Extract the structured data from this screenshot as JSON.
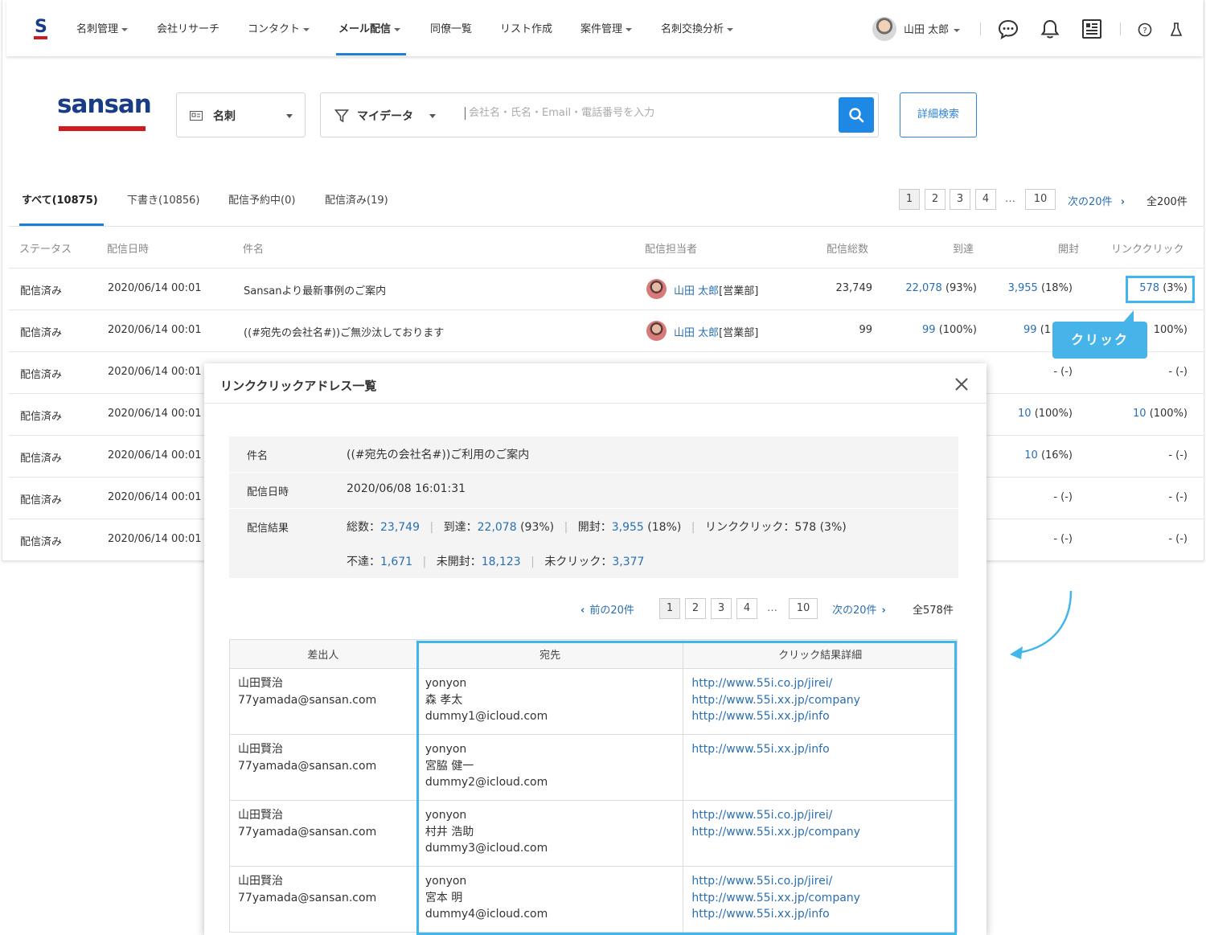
{
  "nav": {
    "items": [
      {
        "label": "名刺管理",
        "caret": true
      },
      {
        "label": "会社リサーチ",
        "caret": false
      },
      {
        "label": "コンタクト",
        "caret": true
      },
      {
        "label": "メール配信",
        "caret": true
      },
      {
        "label": "同僚一覧",
        "caret": false
      },
      {
        "label": "リスト作成",
        "caret": false
      },
      {
        "label": "案件管理",
        "caret": true
      },
      {
        "label": "名刺交換分析",
        "caret": true
      }
    ],
    "user_name": "山田 太郎"
  },
  "search": {
    "logo_text": "sansan",
    "scope_label": "名刺",
    "filter_label": "マイデータ",
    "placeholder": "会社名・氏名・Email・電話番号を入力",
    "advanced_label": "詳細検索"
  },
  "tabs": [
    {
      "label": "すべて(10875)",
      "active": true
    },
    {
      "label": "下書き(10856)",
      "active": false
    },
    {
      "label": "配信予約中(0)",
      "active": false
    },
    {
      "label": "配信済み(19)",
      "active": false
    }
  ],
  "pagination": {
    "pages": [
      "1",
      "2",
      "3",
      "4",
      "10"
    ],
    "current": "1",
    "ellipsis": "…",
    "next_label": "次の20件",
    "total": "全200件"
  },
  "table": {
    "headers": [
      "ステータス",
      "配信日時",
      "件名",
      "配信担当者",
      "配信総数",
      "到達",
      "開封",
      "リンククリック"
    ],
    "rows": [
      {
        "status": "配信済み",
        "date": "2020/06/14 00:01",
        "subject": "Sansanより最新事例のご案内",
        "owner": "山田 太郎",
        "dept": "[営業部]",
        "total": "23,749",
        "reach_n": "22,078",
        "reach_p": "(93%)",
        "open_n": "3,955",
        "open_p": "(18%)",
        "click_n": "578",
        "click_p": "(3%)"
      },
      {
        "status": "配信済み",
        "date": "2020/06/14 00:01",
        "subject": "((#宛先の会社名#))ご無沙汰しております",
        "owner": "山田 太郎",
        "dept": "[営業部]",
        "total": "99",
        "reach_n": "99",
        "reach_p": "(100%)",
        "open_n": "99",
        "open_p": "(1",
        "click_n": "",
        "click_p": "100%)"
      },
      {
        "status": "配信済み",
        "date": "2020/06/14 00:01",
        "open_n": "",
        "open_p": "- (-)",
        "click_n": "",
        "click_p": "- (-)"
      },
      {
        "status": "配信済み",
        "date": "2020/06/14 00:01",
        "open_n": "10",
        "open_p": "(100%)",
        "click_n": "10",
        "click_p": "(100%)"
      },
      {
        "status": "配信済み",
        "date": "2020/06/14 00:01",
        "open_n": "10",
        "open_p": "(16%)",
        "click_n": "",
        "click_p": "- (-)"
      },
      {
        "status": "配信済み",
        "date": "2020/06/14 00:01",
        "open_n": "",
        "open_p": "- (-)",
        "click_n": "",
        "click_p": "- (-)"
      },
      {
        "status": "配信済み",
        "date": "2020/06/14 00:01",
        "open_n": "",
        "open_p": "- (-)",
        "click_n": "",
        "click_p": "- (-)"
      }
    ]
  },
  "tooltip": {
    "label": "クリック"
  },
  "modal": {
    "title": "リンククリックアドレス一覧",
    "info": {
      "subject_label": "件名",
      "subject": "((#宛先の会社名#))ご利用のご案内",
      "date_label": "配信日時",
      "date": "2020/06/08 16:01:31",
      "result_label": "配信結果",
      "total_label": "総数：",
      "total": "23,749",
      "reach_label": "到達：",
      "reach": "22,078",
      "reach_p": "(93%)",
      "open_label": "開封：",
      "open": "3,955",
      "open_p": "(18%)",
      "click_label": "リンククリック：578 (3%)",
      "undelivered_label": "不達：",
      "undelivered": "1,671",
      "unopened_label": "未開封：",
      "unopened": "18,123",
      "unclicked_label": "未クリック：",
      "unclicked": "3,377"
    },
    "pagination": {
      "prev_label": "前の20件",
      "pages": [
        "1",
        "2",
        "3",
        "4",
        "10"
      ],
      "ellipsis": "…",
      "next_label": "次の20件",
      "total": "全578件"
    },
    "table": {
      "headers": [
        "差出人",
        "宛先",
        "クリック結果詳細"
      ],
      "rows": [
        {
          "sender": [
            "山田賢治",
            "77yamada@sansan.com"
          ],
          "recipient": [
            "yonyon",
            "森 孝太",
            "dummy1@icloud.com"
          ],
          "links": [
            "http://www.55i.co.jp/jirei/",
            "http://www.55i.xx.jp/company",
            "http://www.55i.xx.jp/info"
          ]
        },
        {
          "sender": [
            "山田賢治",
            "77yamada@sansan.com"
          ],
          "recipient": [
            "yonyon",
            "宮脇 健一",
            "dummy2@icloud.com"
          ],
          "links": [
            "http://www.55i.xx.jp/info"
          ]
        },
        {
          "sender": [
            "山田賢治",
            "77yamada@sansan.com"
          ],
          "recipient": [
            "yonyon",
            "村井 浩助",
            "dummy3@icloud.com"
          ],
          "links": [
            "http://www.55i.co.jp/jirei/",
            "http://www.55i.xx.jp/company"
          ]
        },
        {
          "sender": [
            "山田賢治",
            "77yamada@sansan.com"
          ],
          "recipient": [
            "yonyon",
            "宮本 明",
            "dummy4@icloud.com"
          ],
          "links": [
            "http://www.55i.co.jp/jirei/",
            "http://www.55i.xx.jp/company",
            "http://www.55i.xx.jp/info"
          ]
        }
      ]
    }
  },
  "colors": {
    "accent": "#1e88e5",
    "highlight": "#41b6ea",
    "brand_red": "#d11922",
    "brand_navy": "#183d86",
    "link": "#2a6fb0"
  }
}
